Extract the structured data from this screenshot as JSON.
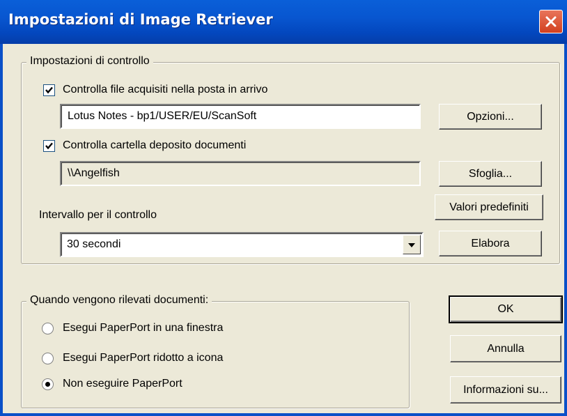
{
  "window": {
    "title": "Impostazioni di Image Retriever"
  },
  "monitor_group": {
    "legend": "Impostazioni di controllo",
    "mail_check": {
      "label": "Controlla file acquisiti nella posta in arrivo",
      "checked": true,
      "field_value": "Lotus Notes - bp1/USER/EU/ScanSoft"
    },
    "folder_check": {
      "label": "Controlla cartella deposito documenti",
      "checked": true,
      "field_value": "\\\\Angelfish"
    },
    "interval": {
      "label": "Intervallo per il controllo",
      "selected": "30 secondi"
    },
    "buttons": {
      "options": "Opzioni...",
      "browse": "Sfoglia...",
      "defaults": "Valori predefiniti",
      "process": "Elabora"
    }
  },
  "detected_group": {
    "legend": "Quando vengono rilevati documenti:",
    "options": [
      {
        "label": "Esegui PaperPort in una finestra",
        "selected": false
      },
      {
        "label": "Esegui PaperPort ridotto a icona",
        "selected": false
      },
      {
        "label": "Non eseguire PaperPort",
        "selected": true
      }
    ]
  },
  "dialog_buttons": {
    "ok": "OK",
    "cancel": "Annulla",
    "about": "Informazioni su..."
  },
  "colors": {
    "titlebar": "#0856d0",
    "close_button": "#d2401f",
    "dialog_background": "#ece9d8"
  },
  "icons": {
    "close": "close-icon",
    "checkbox": "checkmark-icon",
    "dropdown": "chevron-down-icon",
    "radio": "radio-dot-icon"
  }
}
